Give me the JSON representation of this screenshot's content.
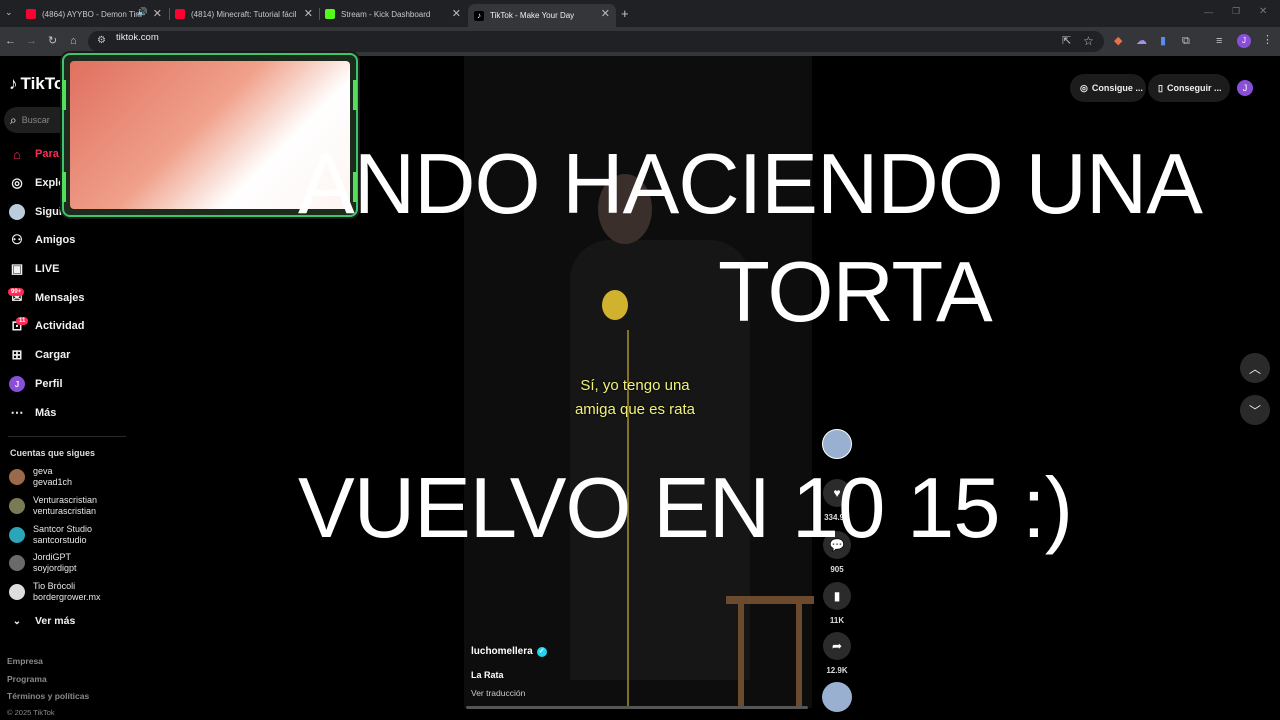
{
  "browser": {
    "tabs": [
      {
        "title": "(4864) AYYBO - Demon Tim",
        "favicon_color": "#ff0033",
        "audio": true
      },
      {
        "title": "(4814) Minecraft: Tutorial fácil",
        "favicon_color": "#ff0033"
      },
      {
        "title": "Stream - Kick Dashboard",
        "favicon_color": "#53fc18"
      },
      {
        "title": "TikTok - Make Your Day",
        "favicon_color": "#ffffff"
      }
    ],
    "new_tab": "+",
    "url": "tiktok.com",
    "profile_initial": "J"
  },
  "sidebar": {
    "logo": "TikTok",
    "search_placeholder": "Buscar",
    "items": [
      {
        "label": "Para ti",
        "icon": "home-icon"
      },
      {
        "label": "Explorar",
        "icon": "compass-icon"
      },
      {
        "label": "Siguiendo",
        "icon": "following-icon"
      },
      {
        "label": "Amigos",
        "icon": "friends-icon"
      },
      {
        "label": "LIVE",
        "icon": "live-icon"
      },
      {
        "label": "Mensajes",
        "icon": "messages-icon",
        "badge": "99+"
      },
      {
        "label": "Actividad",
        "icon": "activity-icon",
        "badge": "11"
      },
      {
        "label": "Cargar",
        "icon": "upload-icon"
      },
      {
        "label": "Perfil",
        "icon": "profile-icon"
      },
      {
        "label": "Más",
        "icon": "more-icon"
      }
    ],
    "following_title": "Cuentas que sigues",
    "following": [
      {
        "name": "geva",
        "handle": "gevad1ch",
        "avatar_color": "#9a6a4a"
      },
      {
        "name": "Venturascristian",
        "handle": "venturascristian",
        "avatar_color": "#7a7a55"
      },
      {
        "name": "Santcor Studio",
        "handle": "santcorstudio",
        "avatar_color": "#2aa6b8"
      },
      {
        "name": "JordiGPT",
        "handle": "soyjordigpt",
        "avatar_color": "#6a6a6a"
      },
      {
        "name": "Tio Brócoli",
        "handle": "bordergrower.mx",
        "avatar_color": "#dddddd"
      }
    ],
    "see_more": "Ver más",
    "footer": [
      "Empresa",
      "Programa",
      "Términos y políticas",
      "© 2025 TikTok"
    ]
  },
  "topbar": {
    "coins_label": "Consigue ...",
    "app_label": "Conseguir ...",
    "avatar_initial": "J"
  },
  "video": {
    "subtitle_line1": "Sí, yo tengo una",
    "subtitle_line2": "amiga que es rata",
    "author": "luchomellera",
    "caption": "La Rata",
    "translate": "Ver traducción",
    "likes": "334.9K",
    "comments": "905",
    "saves": "11K",
    "shares": "12.9K"
  },
  "overlay": {
    "line1": "ANDO HACIENDO UNA",
    "line2": "TORTA",
    "line3": "VUELVO EN 10 15 :)"
  }
}
